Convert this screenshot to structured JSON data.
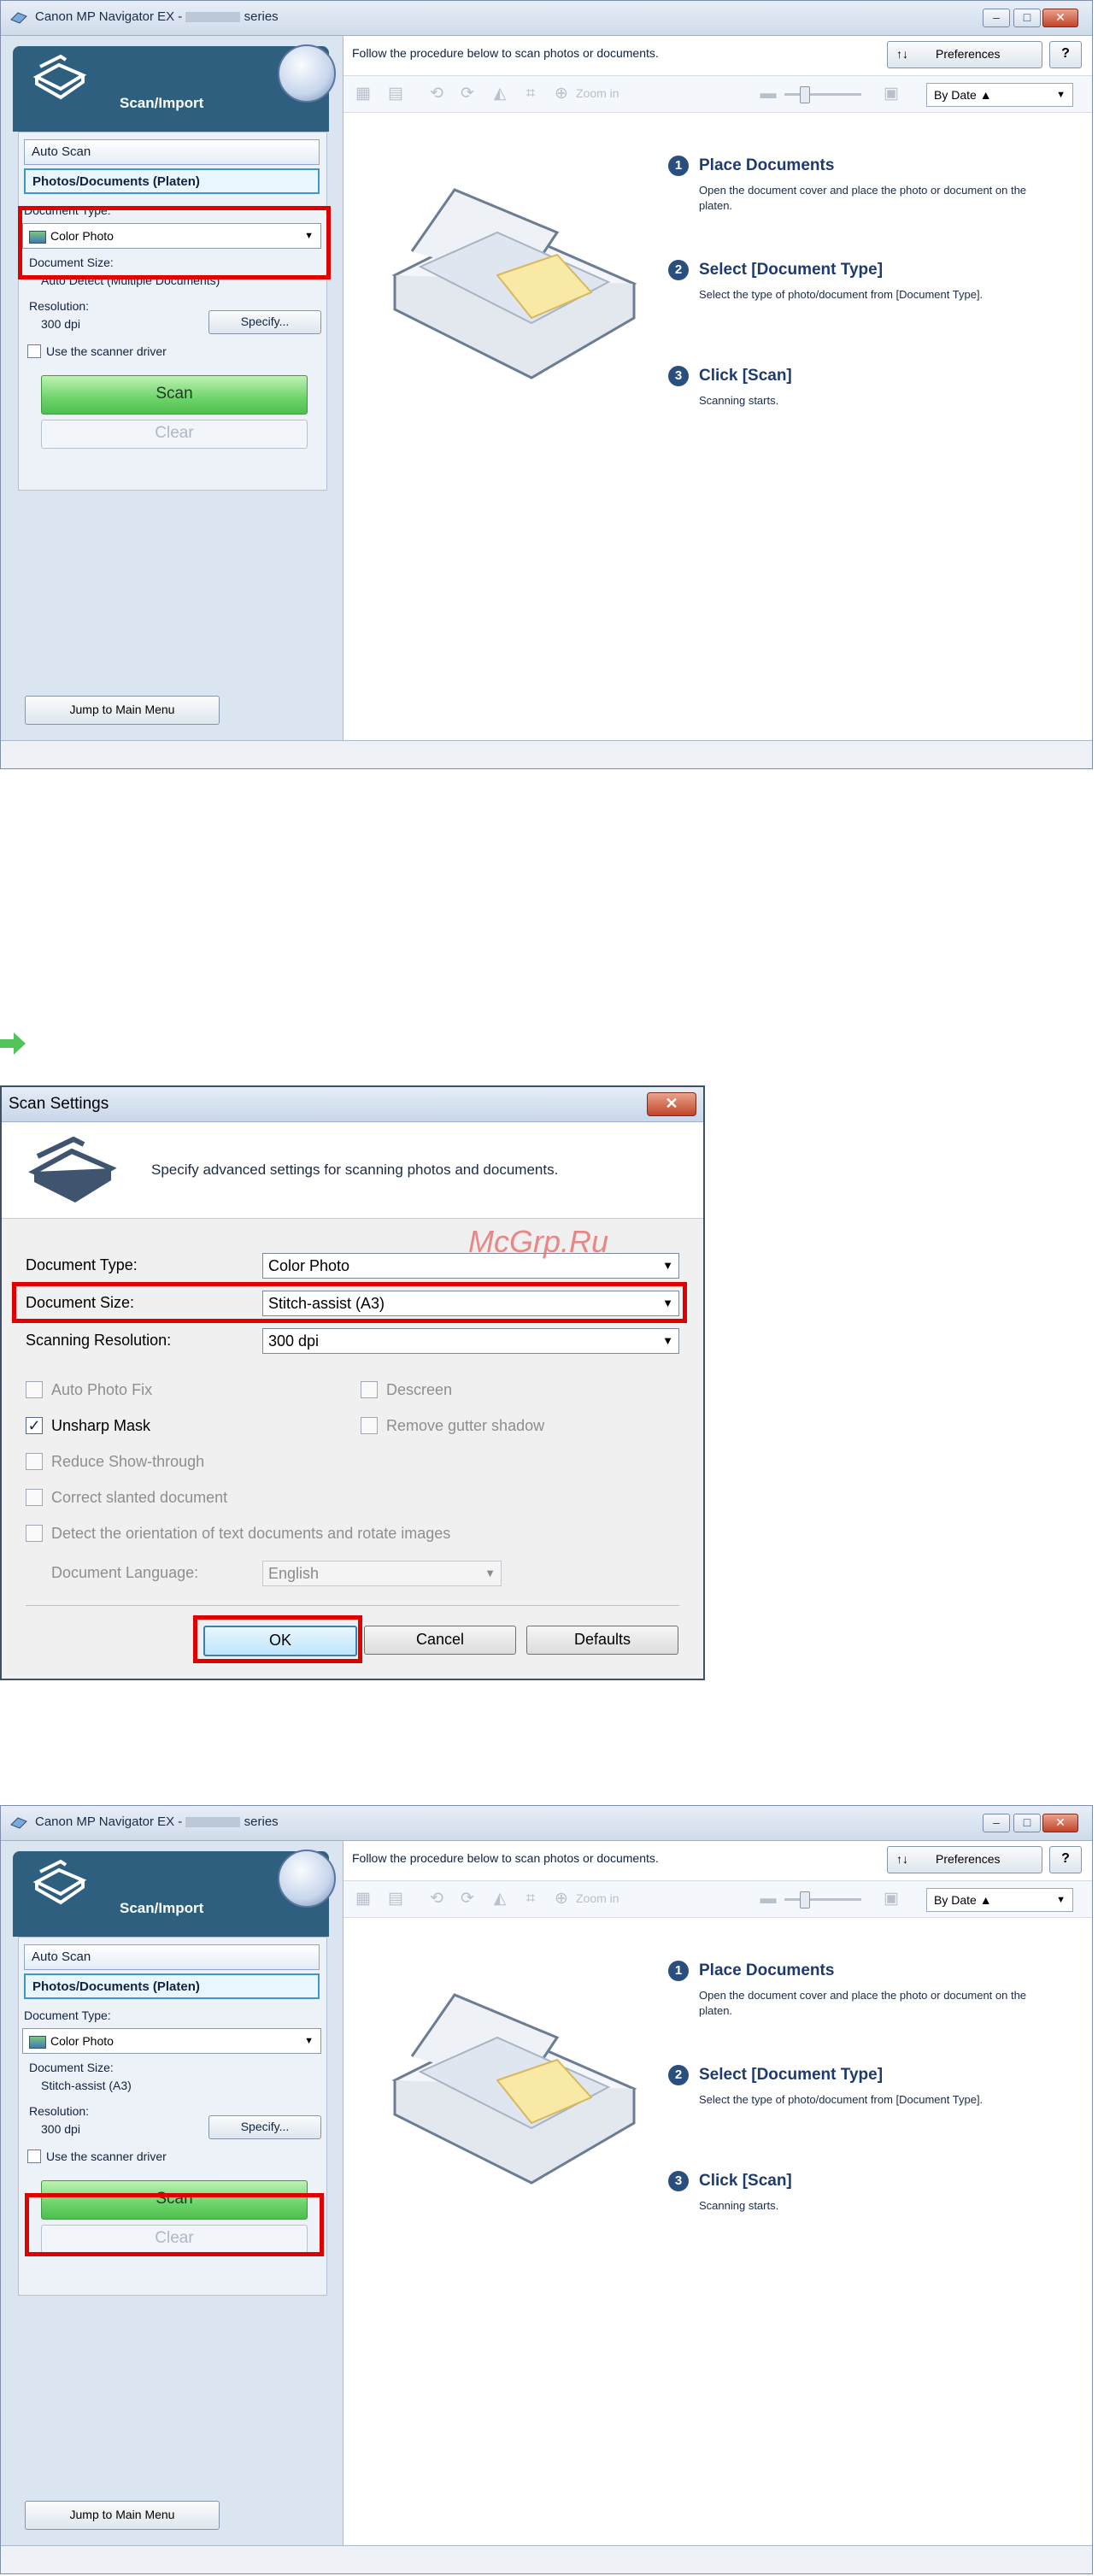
{
  "window1": {
    "title": "Canon MP Navigator EX -",
    "title_suffix": "series",
    "scan_import": "Scan/Import",
    "tabs": [
      "Auto Scan",
      "Photos/Documents (Platen)"
    ],
    "doc_type_label": "Document Type:",
    "doc_type_value": "Color Photo",
    "doc_size_label": "Document Size:",
    "doc_size_value": "Auto Detect (Multiple Documents)",
    "resolution_label": "Resolution:",
    "resolution_value": "300 dpi",
    "specify": "Specify...",
    "use_driver": "Use the scanner driver",
    "scan": "Scan",
    "clear": "Clear",
    "jump": "Jump to Main Menu",
    "instruction": "Follow the procedure below to scan photos or documents.",
    "preferences": "Preferences",
    "preferences_icon": "↑↓",
    "help": "?",
    "zoom_in": "Zoom in",
    "sort": "By Date",
    "steps": [
      {
        "num": "1",
        "title": "Place Documents",
        "desc": "Open the document cover and place the photo or document on the platen."
      },
      {
        "num": "2",
        "title": "Select [Document Type]",
        "desc": "Select the type of photo/document from [Document Type]."
      },
      {
        "num": "3",
        "title": "Click [Scan]",
        "desc": "Scanning starts."
      }
    ]
  },
  "dialog": {
    "title": "Scan Settings",
    "close": "✕",
    "header": "Specify advanced settings for scanning photos and documents.",
    "doc_type_label": "Document Type:",
    "doc_type_value": "Color Photo",
    "doc_size_label": "Document Size:",
    "doc_size_value": "Stitch-assist (A3)",
    "resolution_label": "Scanning Resolution:",
    "resolution_value": "300 dpi",
    "checks": [
      {
        "label": "Auto Photo Fix",
        "checked": false,
        "enabled": false
      },
      {
        "label": "Descreen",
        "checked": false,
        "enabled": false
      },
      {
        "label": "Unsharp Mask",
        "checked": true,
        "enabled": true
      },
      {
        "label": "Remove gutter shadow",
        "checked": false,
        "enabled": false
      },
      {
        "label": "Reduce Show-through",
        "checked": false,
        "enabled": false
      },
      {
        "label": "Correct slanted document",
        "checked": false,
        "enabled": false
      },
      {
        "label": "Detect the orientation of text documents and rotate images",
        "checked": false,
        "enabled": false
      }
    ],
    "lang_label": "Document Language:",
    "lang_value": "English",
    "ok": "OK",
    "cancel": "Cancel",
    "defaults": "Defaults"
  },
  "window2": {
    "doc_size_value": "Stitch-assist (A3)"
  },
  "watermark": "McGrp.Ru",
  "colors": {
    "highlight": "#e10000",
    "scan_green": "#6cd36a",
    "accent": "#2e5f7e"
  }
}
